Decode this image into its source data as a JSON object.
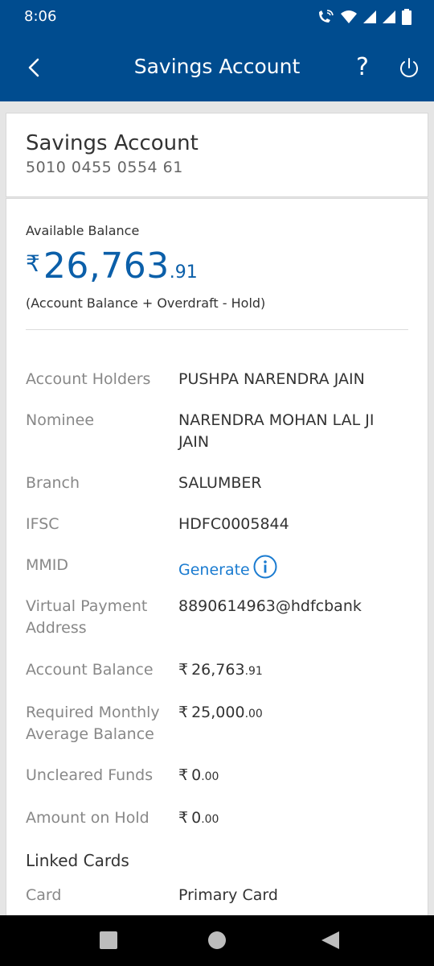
{
  "status": {
    "time": "8:06",
    "icons": [
      "wifi-call-icon",
      "wifi-icon",
      "signal-icon",
      "signal-icon",
      "battery-icon"
    ]
  },
  "appbar": {
    "title": "Savings Account",
    "back_icon": "chevron-left-icon",
    "help_label": "?",
    "power_icon": "power-icon"
  },
  "account": {
    "type": "Savings Account",
    "number": "5010 0455 0554 61"
  },
  "balance": {
    "label": "Available Balance",
    "currency": "₹",
    "main": "26,763",
    "decimal": ".91",
    "note": "(Account Balance + Overdraft - Hold)"
  },
  "details": {
    "account_holders_label": "Account Holders",
    "account_holders_value": "PUSHPA NARENDRA JAIN",
    "nominee_label": "Nominee",
    "nominee_value": "NARENDRA MOHAN LAL JI JAIN",
    "branch_label": "Branch",
    "branch_value": "SALUMBER",
    "ifsc_label": "IFSC",
    "ifsc_value": "HDFC0005844",
    "mmid_label": "MMID",
    "mmid_value": "Generate",
    "vpa_label": "Virtual Payment Address",
    "vpa_value": "8890614963@hdfcbank",
    "account_balance_label": "Account Balance",
    "account_balance_main": "26,763",
    "account_balance_dec": ".91",
    "required_mab_label": "Required Monthly Average Balance",
    "required_mab_main": "25,000",
    "required_mab_dec": ".00",
    "uncleared_label": "Uncleared Funds",
    "uncleared_main": "0",
    "uncleared_dec": ".00",
    "hold_label": "Amount on Hold",
    "hold_main": "0",
    "hold_dec": ".00",
    "currency": "₹"
  },
  "linked_cards": {
    "title": "Linked Cards",
    "card_label": "Card",
    "card_value": "Primary Card"
  },
  "colors": {
    "header": "#004c8f",
    "accent_blue": "#0b5fa9",
    "link_blue": "#1a7bd0"
  }
}
